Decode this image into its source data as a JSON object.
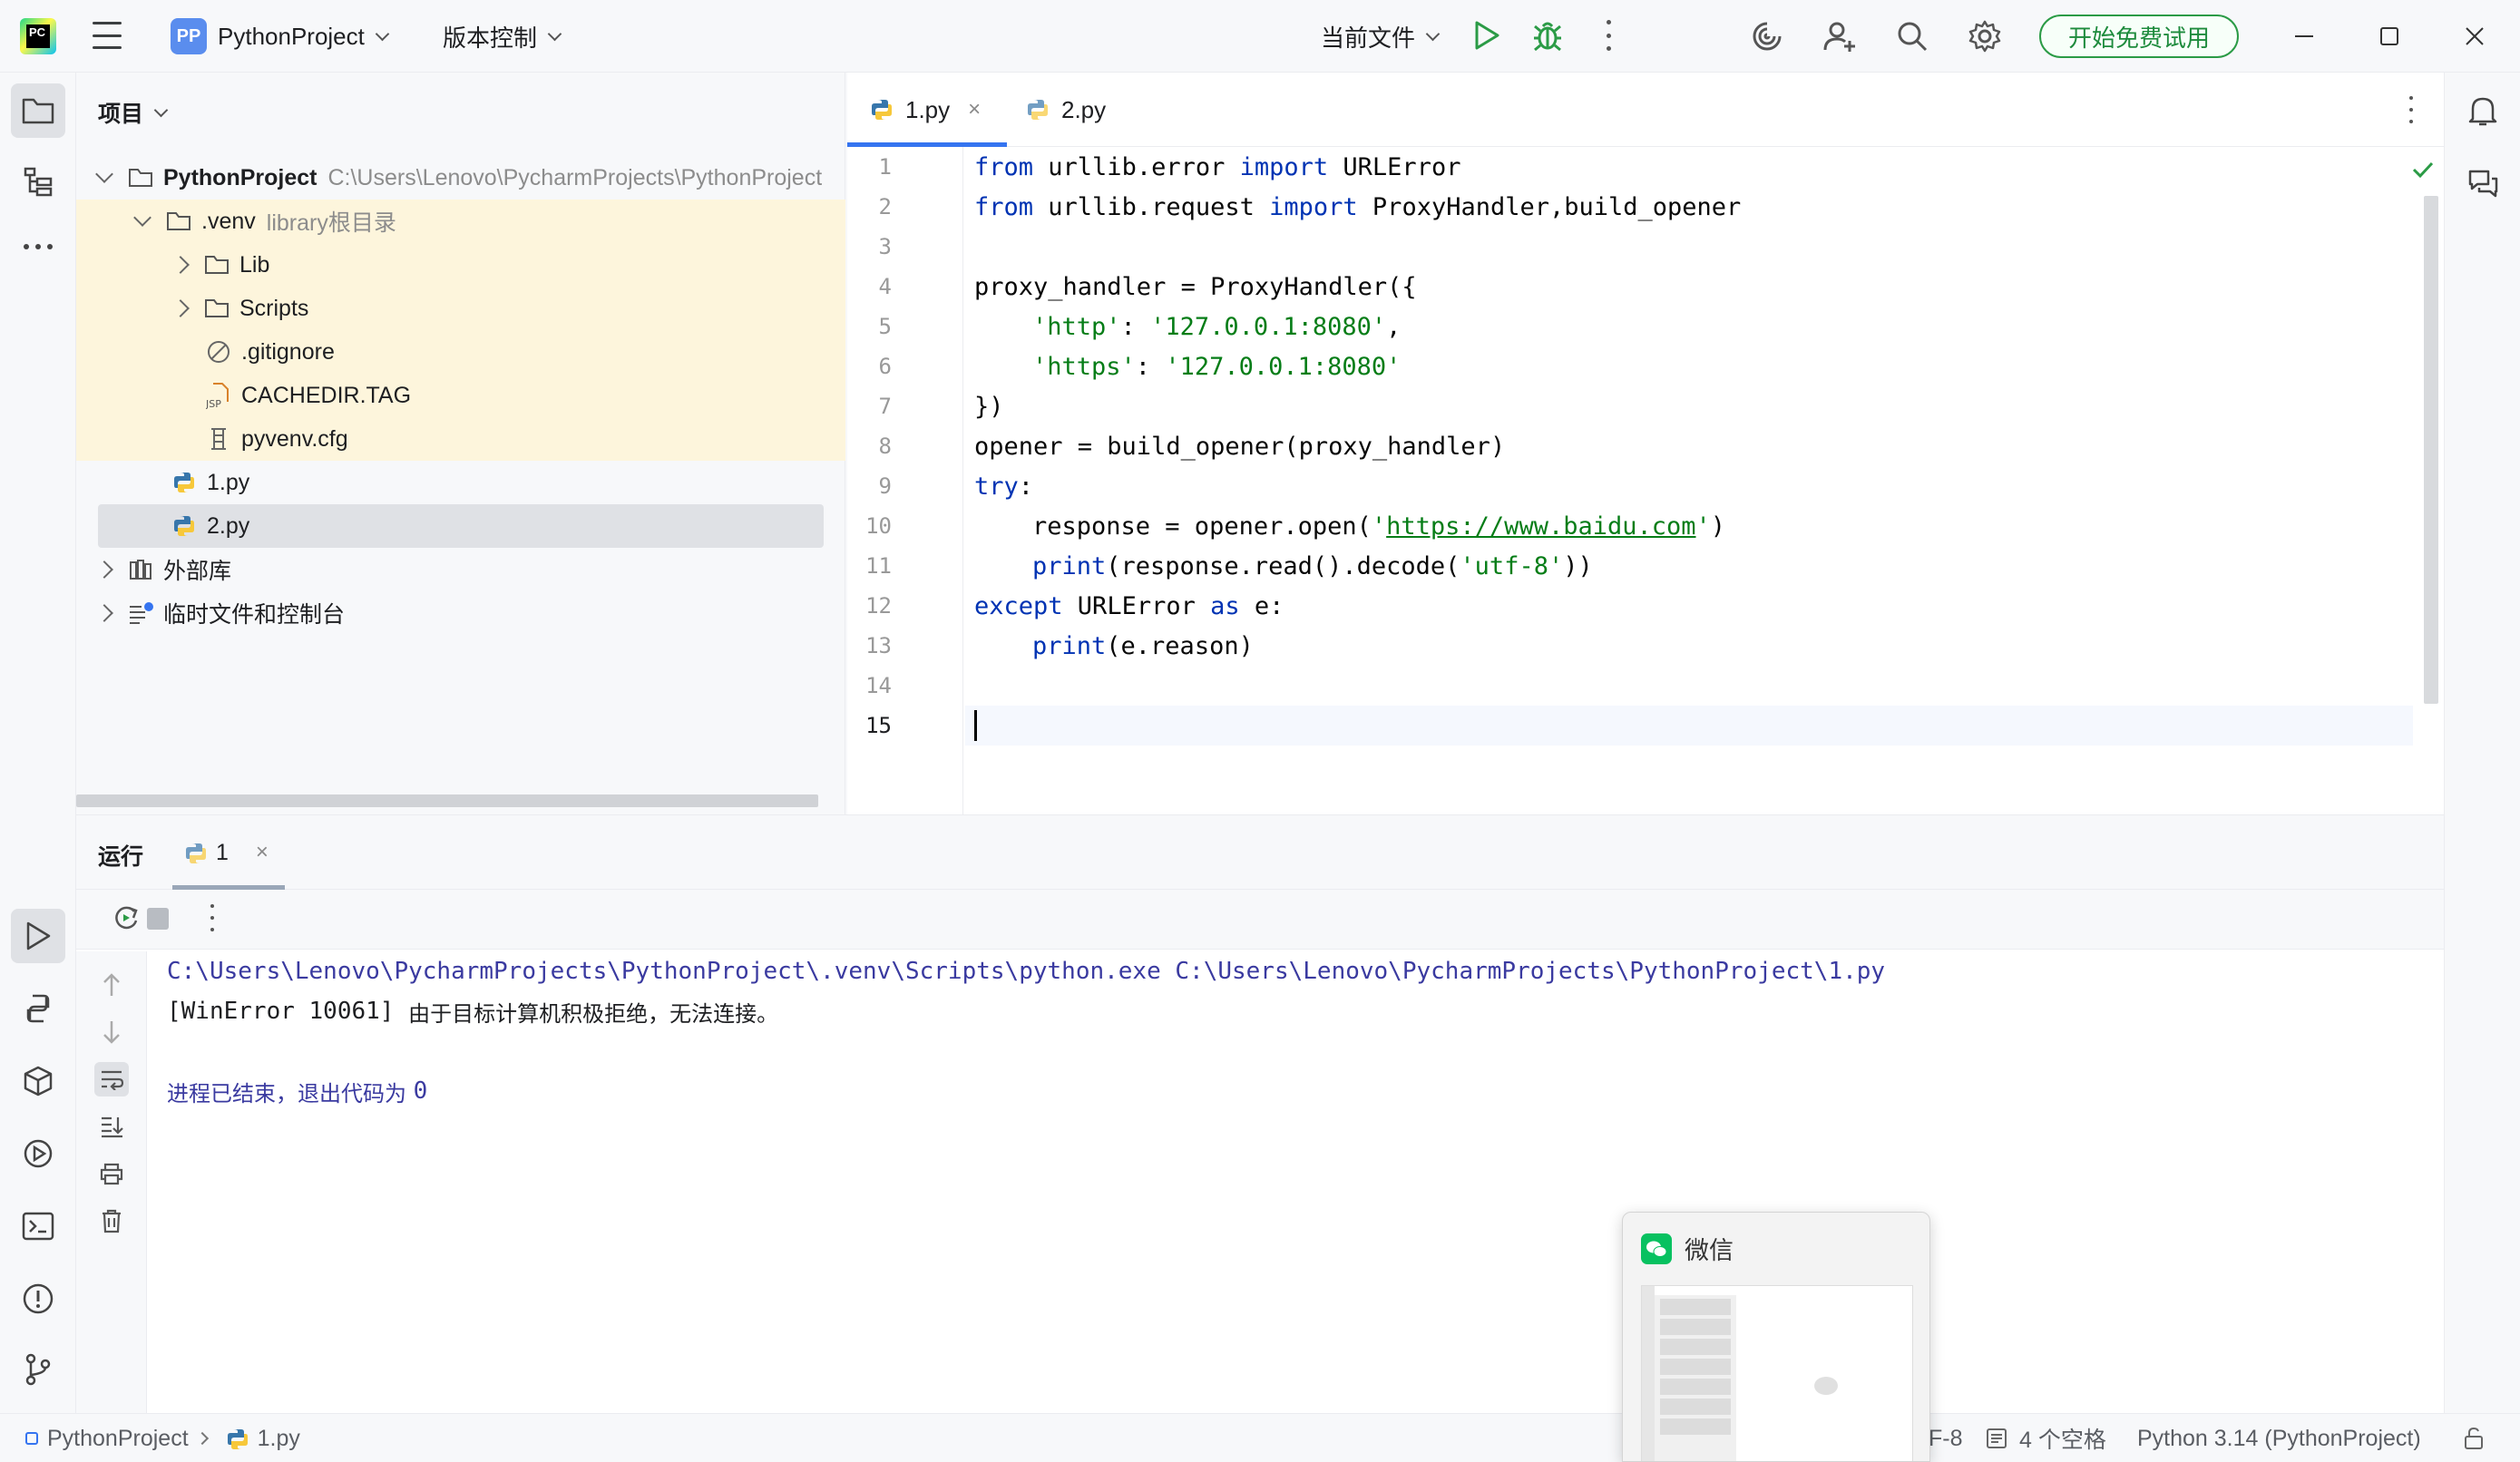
{
  "titlebar": {
    "logo_text": "PC",
    "project_badge": "PP",
    "project_name": "PythonProject",
    "vcs_label": "版本控制",
    "run_config": "当前文件",
    "trial_button": "开始免费试用"
  },
  "project_panel": {
    "title": "项目",
    "tree": [
      {
        "label": "PythonProject",
        "hint": "C:\\Users\\Lenovo\\PycharmProjects\\PythonProject"
      },
      {
        "label": ".venv",
        "hint": "library根目录"
      },
      {
        "label": "Lib"
      },
      {
        "label": "Scripts"
      },
      {
        "label": ".gitignore"
      },
      {
        "label": "CACHEDIR.TAG"
      },
      {
        "label": "pyvenv.cfg"
      },
      {
        "label": "1.py"
      },
      {
        "label": "2.py"
      },
      {
        "label": "外部库"
      },
      {
        "label": "临时文件和控制台"
      }
    ]
  },
  "editor": {
    "tabs": [
      {
        "label": "1.py",
        "close": "×"
      },
      {
        "label": "2.py"
      }
    ],
    "line_numbers": [
      "1",
      "2",
      "3",
      "4",
      "5",
      "6",
      "7",
      "8",
      "9",
      "10",
      "11",
      "12",
      "13",
      "14",
      "15"
    ],
    "code": {
      "l1_kw1": "from",
      "l1_mod": " urllib.error ",
      "l1_kw2": "import",
      "l1_name": " URLError",
      "l2_kw1": "from",
      "l2_mod": " urllib.request ",
      "l2_kw2": "import",
      "l2_name": " ProxyHandler,build_opener",
      "l4": "proxy_handler = ProxyHandler({",
      "l5_key": "'http'",
      "l5_colon": ": ",
      "l5_val": "'127.0.0.1:8080'",
      "l5_end": ",",
      "l6_key": "'https'",
      "l6_colon": ": ",
      "l6_val": "'127.0.0.1:8080'",
      "l7": "})",
      "l8": "opener = build_opener(proxy_handler)",
      "l9_kw": "try",
      "l9_end": ":",
      "l10_pre": "response = opener.open(",
      "l10_q1": "'",
      "l10_url": "https://www.baidu.com",
      "l10_q2": "'",
      "l10_end": ")",
      "l11_fn": "print",
      "l11_mid": "(response.read().decode(",
      "l11_str": "'utf-8'",
      "l11_end": "))",
      "l12_kw1": "except",
      "l12_mid": " URLError ",
      "l12_kw2": "as",
      "l12_end": " e:",
      "l13_fn": "print",
      "l13_end": "(e.reason)"
    }
  },
  "run_panel": {
    "title": "运行",
    "tab_label": "1",
    "tab_close": "×",
    "console": {
      "cmd": "C:\\Users\\Lenovo\\PycharmProjects\\PythonProject\\.venv\\Scripts\\python.exe C:\\Users\\Lenovo\\PycharmProjects\\PythonProject\\1.py",
      "error_code": "[WinError 10061] ",
      "error_msg": "由于目标计算机积极拒绝，无法连接。",
      "exit_msg": "进程已结束，退出代码为 ",
      "exit_code": "0"
    }
  },
  "statusbar": {
    "project": "PythonProject",
    "file": "1.py",
    "encoding": "F-8",
    "indent": "4 个空格",
    "interpreter": "Python 3.14 (PythonProject)"
  },
  "wechat": {
    "title": "微信"
  },
  "colors": {
    "accent": "#3574f0",
    "keyword": "#0033b3",
    "string": "#067d17",
    "venv_bg": "#fdf5dc",
    "trial": "#1e8b3d"
  }
}
